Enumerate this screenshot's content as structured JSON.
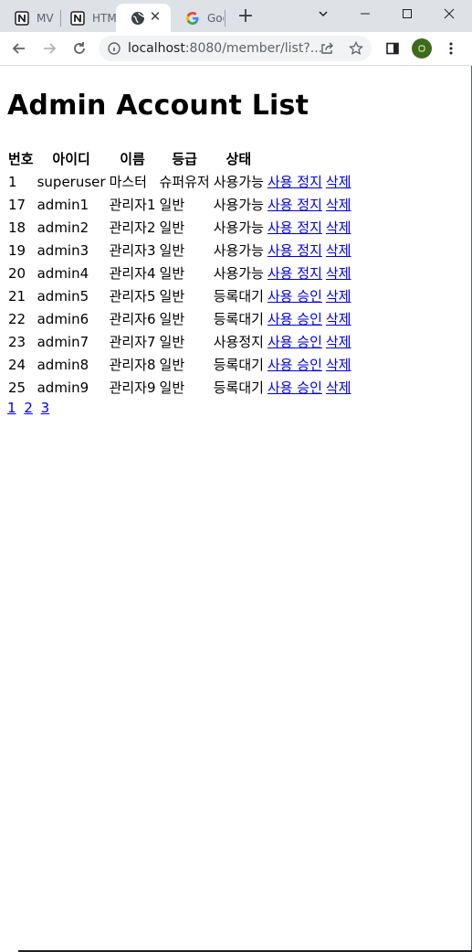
{
  "browser": {
    "tabs": [
      {
        "title": "MV",
        "favicon": "notion-icon"
      },
      {
        "title": "HTM",
        "favicon": "notion-icon"
      },
      {
        "title": "",
        "favicon": "globe-icon",
        "active": true
      },
      {
        "title": "Goo",
        "favicon": "google-icon"
      }
    ],
    "new_tab_label": "+",
    "url_host": "localhost",
    "url_path": ":8080/member/list?...",
    "profile_initial": "o"
  },
  "page": {
    "title": "Admin Account List",
    "columns": [
      "번호",
      "아이디",
      "이름",
      "등급",
      "상태"
    ],
    "rows": [
      {
        "no": "1",
        "id": "superuser",
        "name": "마스터",
        "grade": "슈퍼유저",
        "status": "사용가능",
        "action": "사용 정지",
        "delete": "삭제"
      },
      {
        "no": "17",
        "id": "admin1",
        "name": "관리자1",
        "grade": "일반",
        "status": "사용가능",
        "action": "사용 정지",
        "delete": "삭제"
      },
      {
        "no": "18",
        "id": "admin2",
        "name": "관리자2",
        "grade": "일반",
        "status": "사용가능",
        "action": "사용 정지",
        "delete": "삭제"
      },
      {
        "no": "19",
        "id": "admin3",
        "name": "관리자3",
        "grade": "일반",
        "status": "사용가능",
        "action": "사용 정지",
        "delete": "삭제"
      },
      {
        "no": "20",
        "id": "admin4",
        "name": "관리자4",
        "grade": "일반",
        "status": "사용가능",
        "action": "사용 정지",
        "delete": "삭제"
      },
      {
        "no": "21",
        "id": "admin5",
        "name": "관리자5",
        "grade": "일반",
        "status": "등록대기",
        "action": "사용 승인",
        "delete": "삭제"
      },
      {
        "no": "22",
        "id": "admin6",
        "name": "관리자6",
        "grade": "일반",
        "status": "등록대기",
        "action": "사용 승인",
        "delete": "삭제"
      },
      {
        "no": "23",
        "id": "admin7",
        "name": "관리자7",
        "grade": "일반",
        "status": "사용정지",
        "action": "사용 승인",
        "delete": "삭제"
      },
      {
        "no": "24",
        "id": "admin8",
        "name": "관리자8",
        "grade": "일반",
        "status": "등록대기",
        "action": "사용 승인",
        "delete": "삭제"
      },
      {
        "no": "25",
        "id": "admin9",
        "name": "관리자9",
        "grade": "일반",
        "status": "등록대기",
        "action": "사용 승인",
        "delete": "삭제"
      }
    ],
    "pagination": [
      "1",
      "2",
      "3"
    ]
  },
  "colors": {
    "link": "#0000ee",
    "tabstrip": "#dee1e6",
    "avatar": "#3e6b1b"
  }
}
